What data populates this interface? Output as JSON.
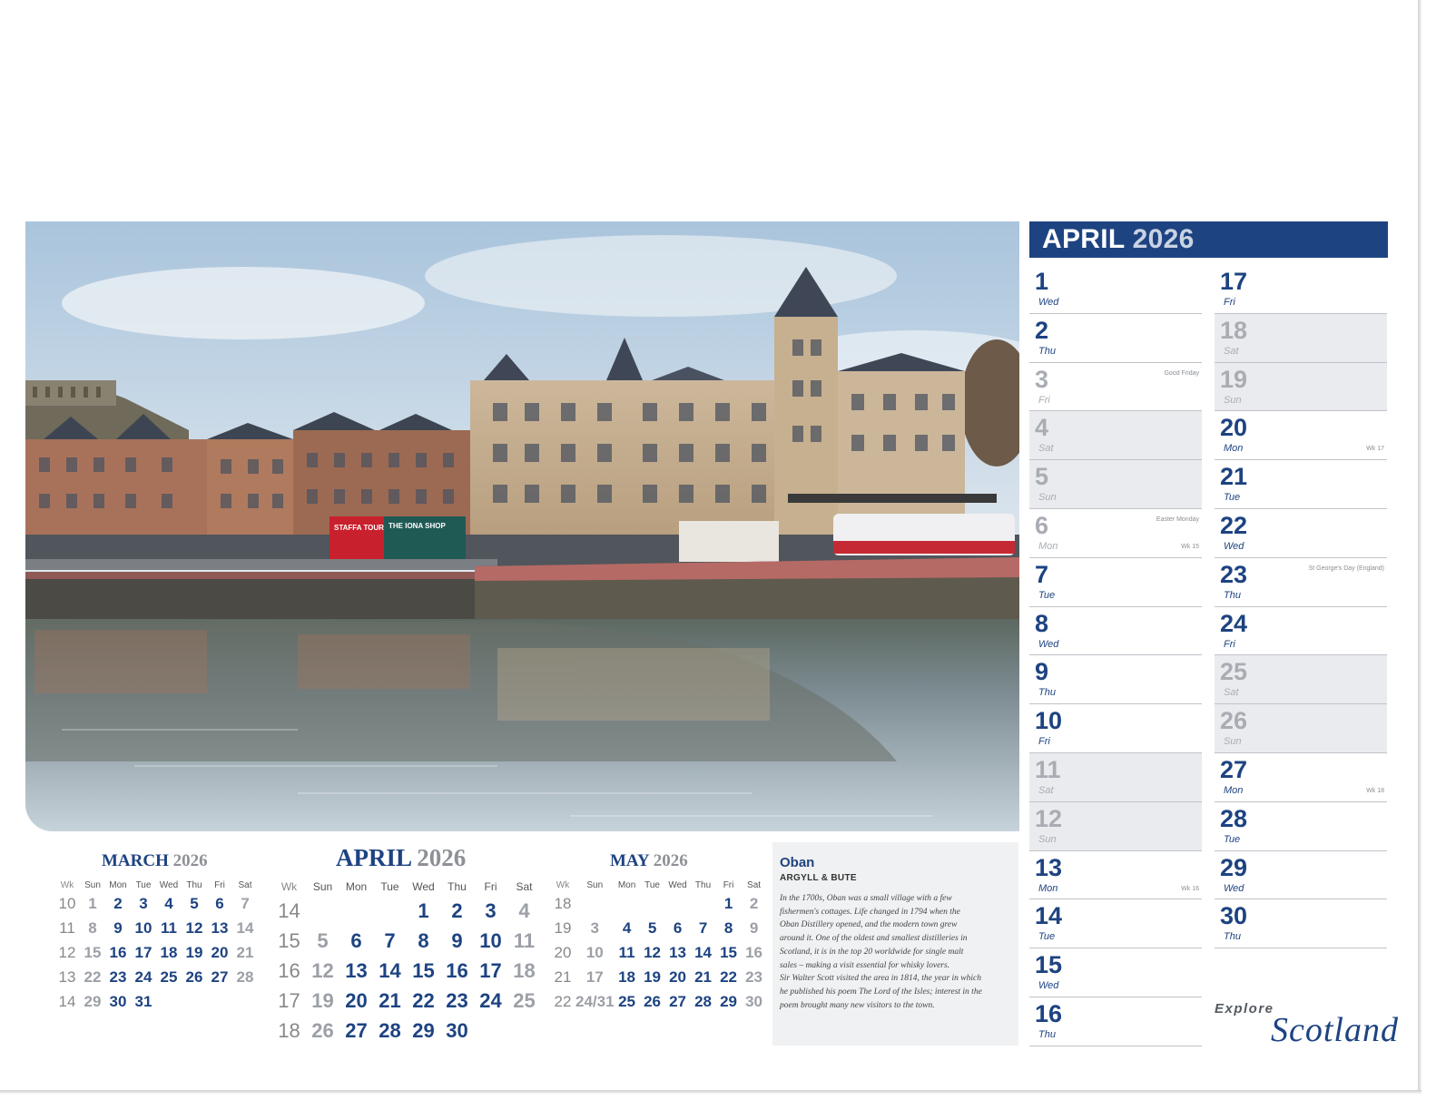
{
  "header": {
    "month": "APRIL",
    "year": "2026"
  },
  "days_col1": [
    {
      "num": "1",
      "name": "Wed",
      "type": "weekday",
      "note": "",
      "wk": ""
    },
    {
      "num": "2",
      "name": "Thu",
      "type": "weekday",
      "note": "",
      "wk": ""
    },
    {
      "num": "3",
      "name": "Fri",
      "type": "pubhol",
      "note": "Good Friday",
      "wk": ""
    },
    {
      "num": "4",
      "name": "Sat",
      "type": "weekend",
      "note": "",
      "wk": ""
    },
    {
      "num": "5",
      "name": "Sun",
      "type": "weekend",
      "note": "",
      "wk": ""
    },
    {
      "num": "6",
      "name": "Mon",
      "type": "pubhol",
      "note": "Easter Monday",
      "wk": "Wk 15"
    },
    {
      "num": "7",
      "name": "Tue",
      "type": "weekday",
      "note": "",
      "wk": ""
    },
    {
      "num": "8",
      "name": "Wed",
      "type": "weekday",
      "note": "",
      "wk": ""
    },
    {
      "num": "9",
      "name": "Thu",
      "type": "weekday",
      "note": "",
      "wk": ""
    },
    {
      "num": "10",
      "name": "Fri",
      "type": "weekday",
      "note": "",
      "wk": ""
    },
    {
      "num": "11",
      "name": "Sat",
      "type": "weekend",
      "note": "",
      "wk": ""
    },
    {
      "num": "12",
      "name": "Sun",
      "type": "weekend",
      "note": "",
      "wk": ""
    },
    {
      "num": "13",
      "name": "Mon",
      "type": "weekday",
      "note": "",
      "wk": "Wk 16"
    },
    {
      "num": "14",
      "name": "Tue",
      "type": "weekday",
      "note": "",
      "wk": ""
    },
    {
      "num": "15",
      "name": "Wed",
      "type": "weekday",
      "note": "",
      "wk": ""
    },
    {
      "num": "16",
      "name": "Thu",
      "type": "weekday",
      "note": "",
      "wk": ""
    }
  ],
  "days_col2": [
    {
      "num": "17",
      "name": "Fri",
      "type": "weekday",
      "note": "",
      "wk": ""
    },
    {
      "num": "18",
      "name": "Sat",
      "type": "weekend",
      "note": "",
      "wk": ""
    },
    {
      "num": "19",
      "name": "Sun",
      "type": "weekend",
      "note": "",
      "wk": ""
    },
    {
      "num": "20",
      "name": "Mon",
      "type": "weekday",
      "note": "",
      "wk": "Wk 17"
    },
    {
      "num": "21",
      "name": "Tue",
      "type": "weekday",
      "note": "",
      "wk": ""
    },
    {
      "num": "22",
      "name": "Wed",
      "type": "weekday",
      "note": "",
      "wk": ""
    },
    {
      "num": "23",
      "name": "Thu",
      "type": "weekday",
      "note": "St George's Day (England)",
      "wk": ""
    },
    {
      "num": "24",
      "name": "Fri",
      "type": "weekday",
      "note": "",
      "wk": ""
    },
    {
      "num": "25",
      "name": "Sat",
      "type": "weekend",
      "note": "",
      "wk": ""
    },
    {
      "num": "26",
      "name": "Sun",
      "type": "weekend",
      "note": "",
      "wk": ""
    },
    {
      "num": "27",
      "name": "Mon",
      "type": "weekday",
      "note": "",
      "wk": "Wk 18"
    },
    {
      "num": "28",
      "name": "Tue",
      "type": "weekday",
      "note": "",
      "wk": ""
    },
    {
      "num": "29",
      "name": "Wed",
      "type": "weekday",
      "note": "",
      "wk": ""
    },
    {
      "num": "30",
      "name": "Thu",
      "type": "weekday",
      "note": "",
      "wk": ""
    }
  ],
  "mini_calendars": [
    {
      "month": "MARCH",
      "year": "2026",
      "headers": [
        "Wk",
        "Sun",
        "Mon",
        "Tue",
        "Wed",
        "Thu",
        "Fri",
        "Sat"
      ],
      "rows": [
        [
          "10",
          "1",
          "2",
          "3",
          "4",
          "5",
          "6",
          "7"
        ],
        [
          "11",
          "8",
          "9",
          "10",
          "11",
          "12",
          "13",
          "14"
        ],
        [
          "12",
          "15",
          "16",
          "17",
          "18",
          "19",
          "20",
          "21"
        ],
        [
          "13",
          "22",
          "23",
          "24",
          "25",
          "26",
          "27",
          "28"
        ],
        [
          "14",
          "29",
          "30",
          "31",
          "",
          "",
          "",
          ""
        ]
      ]
    },
    {
      "month": "APRIL",
      "year": "2026",
      "headers": [
        "Wk",
        "Sun",
        "Mon",
        "Tue",
        "Wed",
        "Thu",
        "Fri",
        "Sat"
      ],
      "rows": [
        [
          "14",
          "",
          "",
          "",
          "1",
          "2",
          "3",
          "4"
        ],
        [
          "15",
          "5",
          "6",
          "7",
          "8",
          "9",
          "10",
          "11"
        ],
        [
          "16",
          "12",
          "13",
          "14",
          "15",
          "16",
          "17",
          "18"
        ],
        [
          "17",
          "19",
          "20",
          "21",
          "22",
          "23",
          "24",
          "25"
        ],
        [
          "18",
          "26",
          "27",
          "28",
          "29",
          "30",
          "",
          ""
        ]
      ]
    },
    {
      "month": "MAY",
      "year": "2026",
      "headers": [
        "Wk",
        "Sun",
        "Mon",
        "Tue",
        "Wed",
        "Thu",
        "Fri",
        "Sat"
      ],
      "rows": [
        [
          "18",
          "",
          "",
          "",
          "",
          "",
          "1",
          "2"
        ],
        [
          "19",
          "3",
          "4",
          "5",
          "6",
          "7",
          "8",
          "9"
        ],
        [
          "20",
          "10",
          "11",
          "12",
          "13",
          "14",
          "15",
          "16"
        ],
        [
          "21",
          "17",
          "18",
          "19",
          "20",
          "21",
          "22",
          "23"
        ],
        [
          "22",
          "24/31",
          "25",
          "26",
          "27",
          "28",
          "29",
          "30"
        ]
      ]
    }
  ],
  "info": {
    "title": "Oban",
    "subtitle": "ARGYLL & BUTE",
    "lines": [
      "In the 1700s, Oban was a small village with a few",
      "fishermen's cottages.  Life changed in 1794 when the",
      "Oban Distillery opened, and the modern town grew",
      "around it. One of the oldest and smallest distilleries in",
      "Scotland, it is in the top 20 worldwide for single malt",
      "sales – making a visit essential for whisky lovers.",
      "Sir Walter Scott visited the area in 1814, the year in which",
      "he published his poem The Lord of the Isles; interest in the",
      "poem brought many new  visitors to the town."
    ]
  },
  "photo_signs": {
    "shop1": "STAFFA TOURS",
    "shop2": "THE IONA SHOP"
  },
  "logo": {
    "line1": "Explore",
    "line2": "Scotland"
  },
  "colors": {
    "navy": "#1d4381",
    "grey_text": "#a9adb3",
    "shade": "#e9ebee"
  }
}
